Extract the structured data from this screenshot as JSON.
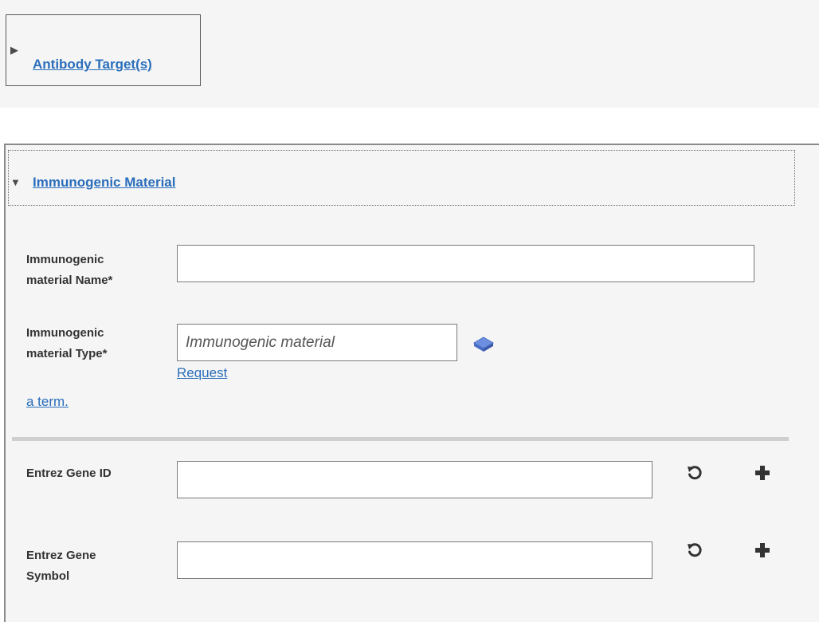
{
  "antibody_section": {
    "toggle_label": "Antibody Target(s)"
  },
  "immunogen_section": {
    "toggle_label": "Immunogenic Material",
    "name_field": {
      "label_line1": "Immunogenic",
      "label_line2": "material Name*",
      "value": ""
    },
    "type_field": {
      "label_line1": "Immunogenic",
      "label_line2": "material Type*",
      "value": "",
      "placeholder": "Immunogenic material",
      "request_link_1": "Request",
      "request_link_2": "a term."
    },
    "gene_id_field": {
      "label": "Entrez Gene ID",
      "value": ""
    },
    "gene_symbol_field": {
      "label_line1": "Entrez Gene",
      "label_line2": "Symbol",
      "value": ""
    }
  },
  "icons": {
    "ontology": "ontology-book-icon",
    "reset": "reset-icon",
    "add": "add-icon"
  },
  "colors": {
    "link": "#2a6ebb",
    "panel_background": "#f5f5f5",
    "ontology_icon": "#5b7fd6"
  }
}
